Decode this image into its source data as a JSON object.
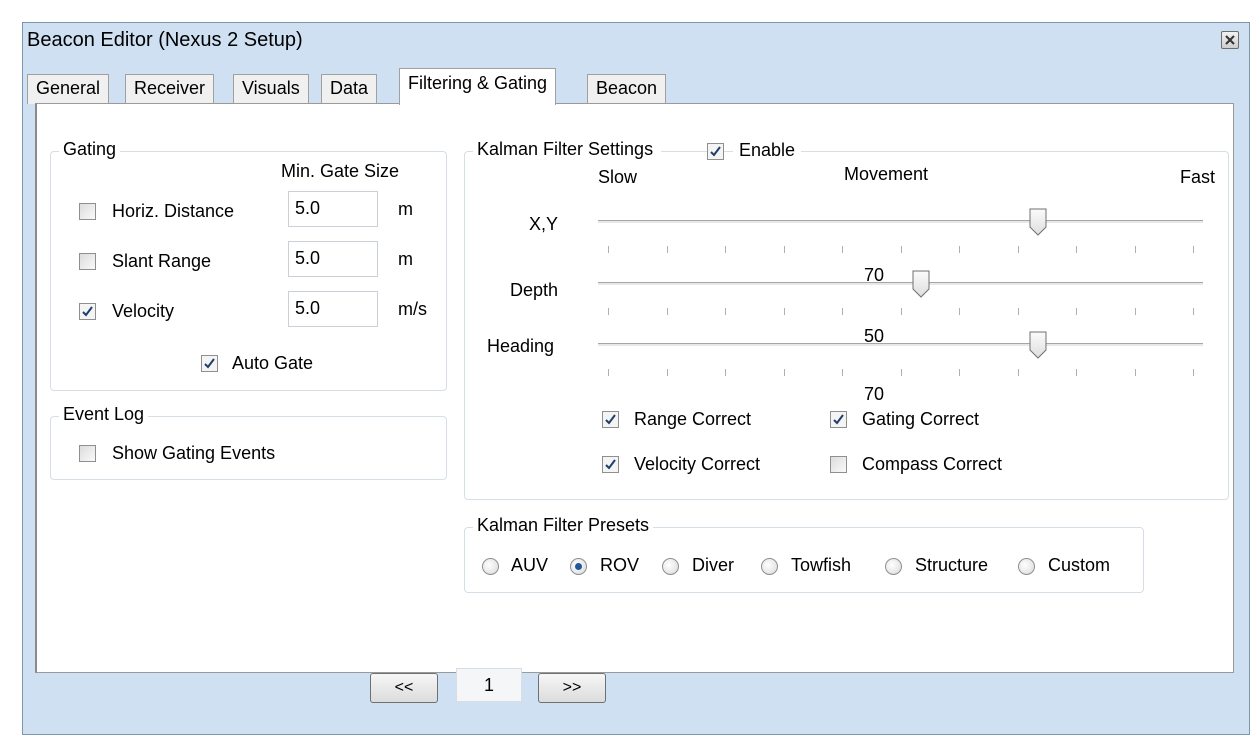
{
  "window": {
    "title": "Beacon Editor (Nexus 2 Setup)"
  },
  "tabs": [
    {
      "label": "General"
    },
    {
      "label": "Receiver"
    },
    {
      "label": "Visuals"
    },
    {
      "label": "Data"
    },
    {
      "label": "Filtering & Gating",
      "active": true
    },
    {
      "label": "Beacon"
    }
  ],
  "gating": {
    "title": "Gating",
    "min_gate_header": "Min. Gate Size",
    "rows": [
      {
        "label": "Horiz. Distance",
        "checked": false,
        "value": "5.0",
        "unit": "m"
      },
      {
        "label": "Slant Range",
        "checked": false,
        "value": "5.0",
        "unit": "m"
      },
      {
        "label": "Velocity",
        "checked": true,
        "value": "5.0",
        "unit": "m/s"
      }
    ],
    "auto_gate": {
      "label": "Auto Gate",
      "checked": true
    }
  },
  "event_log": {
    "title": "Event Log",
    "show_gating_events": {
      "label": "Show Gating Events",
      "checked": false
    }
  },
  "kalman": {
    "title": "Kalman Filter Settings",
    "enable": {
      "label": "Enable",
      "checked": true
    },
    "scale": {
      "slow": "Slow",
      "movement": "Movement",
      "fast": "Fast"
    },
    "sliders": [
      {
        "label": "X,Y",
        "value": 70,
        "value_text": "70"
      },
      {
        "label": "Depth",
        "value": 50,
        "value_text": "50"
      },
      {
        "label": "Heading",
        "value": 70,
        "value_text": "70"
      }
    ],
    "options": [
      {
        "label": "Range Correct",
        "checked": true
      },
      {
        "label": "Gating Correct",
        "checked": true
      },
      {
        "label": "Velocity Correct",
        "checked": true
      },
      {
        "label": "Compass Correct",
        "checked": false
      }
    ]
  },
  "presets": {
    "title": "Kalman Filter Presets",
    "options": [
      {
        "label": "AUV",
        "selected": false
      },
      {
        "label": "ROV",
        "selected": true
      },
      {
        "label": "Diver",
        "selected": false
      },
      {
        "label": "Towfish",
        "selected": false
      },
      {
        "label": "Structure",
        "selected": false
      },
      {
        "label": "Custom",
        "selected": false
      }
    ]
  },
  "pager": {
    "prev": "<<",
    "page": "1",
    "next": ">>"
  }
}
